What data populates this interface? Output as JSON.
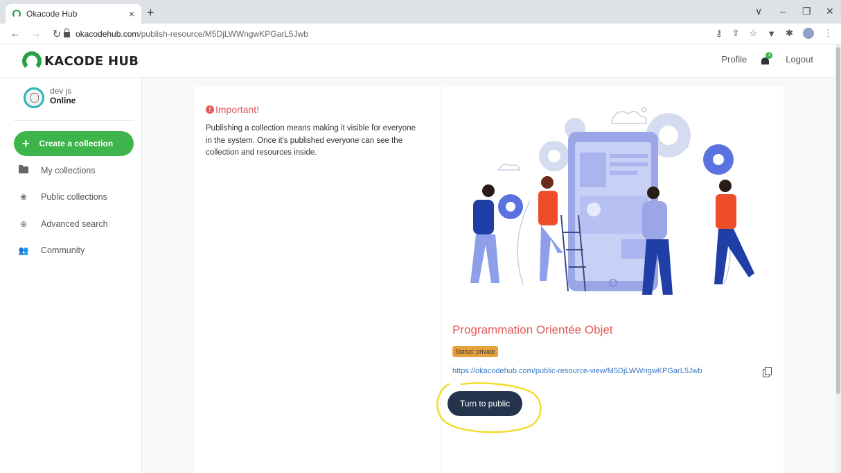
{
  "browser": {
    "tab_title": "Okacode Hub",
    "tab_close": "×",
    "new_tab": "+",
    "url_host": "okacodehub.com",
    "url_path": "/publish-resource/M5DjLWWngwKPGarL5Jwb",
    "controls": [
      "∨",
      "–",
      "❐",
      "✕"
    ]
  },
  "header": {
    "logo_text": "KACODE HUB",
    "profile": "Profile",
    "notification_count": "1",
    "logout": "Logout"
  },
  "sidebar": {
    "user_name": "dev js",
    "user_status": "Online",
    "create_label": "Create a collection",
    "items": [
      {
        "label": "My collections",
        "icon": "folder-icon"
      },
      {
        "label": "Public collections",
        "icon": "collections-icon"
      },
      {
        "label": "Advanced search",
        "icon": "search-icon"
      },
      {
        "label": "Community",
        "icon": "community-icon"
      }
    ]
  },
  "main": {
    "important_title": "Important!",
    "important_text": "Publishing a collection means making it visible for everyone in the system. Once it's published everyone can see the collection and resources inside.",
    "collection_title": "Programmation Orientée Objet",
    "status": "Status: private",
    "public_link": "https://okacodehub.com/public-resource-view/M5DjLWWngwKPGarL5Jwb",
    "turn_public_label": "Turn to public"
  },
  "colors": {
    "brand_green": "#3db54a",
    "accent_red": "#e05b5b",
    "status_orange": "#e8a23c",
    "button_navy": "#25344d",
    "annotation_yellow": "#f5dc2c"
  }
}
